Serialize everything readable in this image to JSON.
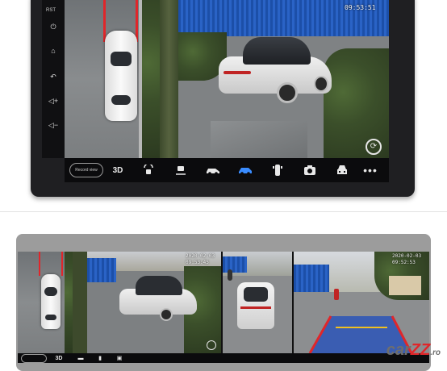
{
  "top_unit": {
    "side_buttons": {
      "rst": "RST",
      "power": "⏻",
      "home": "⌂",
      "back": "↶",
      "vol_up": "◁+",
      "vol_down": "◁−"
    },
    "timestamp_time": "09:53:51",
    "toolbar": {
      "record_label": "Record view",
      "view_3d": "3D",
      "icons": [
        "front-camera-icon",
        "rear-camera-icon",
        "car-side-icon",
        "car-3d-icon",
        "car-top-icon",
        "camera-icon",
        "car-front-icon",
        "more-icon"
      ]
    }
  },
  "bottom_unit": {
    "panel_a_timestamp": "2020-02-03\n09:53:45",
    "panel_b_timestamp": "2020-02-03\n09:52:53",
    "toolbar_3d": "3D"
  },
  "watermark": {
    "main": "car",
    "z": "ZZ",
    "suffix": ".ro"
  },
  "colors": {
    "accent": "#3a8cff",
    "guide_red": "#e0262a",
    "fence_blue": "#2a63c6",
    "watermark_red": "#e0262a"
  }
}
